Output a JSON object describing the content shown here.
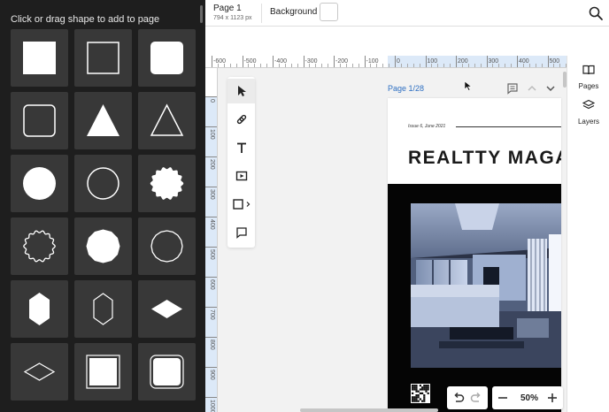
{
  "shapes_panel": {
    "title": "Click or drag shape to add to page",
    "shapes": [
      {
        "name": "filled-square-shape"
      },
      {
        "name": "outline-square-shape"
      },
      {
        "name": "filled-rounded-square-shape"
      },
      {
        "name": "outline-rounded-square-shape"
      },
      {
        "name": "filled-triangle-shape"
      },
      {
        "name": "outline-triangle-shape"
      },
      {
        "name": "filled-circle-shape"
      },
      {
        "name": "outline-circle-shape"
      },
      {
        "name": "filled-scalloped-circle-shape"
      },
      {
        "name": "outline-scalloped-circle-shape"
      },
      {
        "name": "filled-polygon-circle-shape"
      },
      {
        "name": "outline-polygon-circle-shape"
      },
      {
        "name": "filled-hexagon-shape"
      },
      {
        "name": "outline-hexagon-shape"
      },
      {
        "name": "filled-diamond-shape"
      },
      {
        "name": "outline-diamond-shape"
      },
      {
        "name": "framed-square-shape"
      },
      {
        "name": "framed-rounded-square-shape"
      }
    ]
  },
  "topbar": {
    "page_name": "Page 1",
    "page_size": "794 x 1123 px",
    "background_label": "Background",
    "background_color": "#ffffff"
  },
  "rulers": {
    "top_labels": [
      "-600",
      "-500",
      "-400",
      "-300",
      "-200",
      "-100",
      "0",
      "100",
      "200",
      "300",
      "400",
      "500"
    ],
    "left_labels": [
      "0",
      "100",
      "200",
      "300",
      "400",
      "500",
      "600",
      "700",
      "800",
      "900",
      "1000"
    ]
  },
  "tools": [
    {
      "name": "select-tool",
      "icon": "cursor-icon"
    },
    {
      "name": "link-tool",
      "icon": "link-icon"
    },
    {
      "name": "text-tool",
      "icon": "text-icon"
    },
    {
      "name": "video-tool",
      "icon": "video-icon"
    },
    {
      "name": "shape-tool",
      "icon": "square-icon"
    },
    {
      "name": "comment-tool",
      "icon": "comment-icon"
    }
  ],
  "page": {
    "label": "Page 1/28",
    "issue": "Issue 6, June 2021",
    "title": "REALTTY MAGAZ"
  },
  "zoom": {
    "value": "50%"
  },
  "right_panel": {
    "pages_label": "Pages",
    "layers_label": "Layers"
  },
  "colors": {
    "accent": "#2d6fc2",
    "panel_bg": "#1e1e1e",
    "tile_bg": "#383838"
  }
}
